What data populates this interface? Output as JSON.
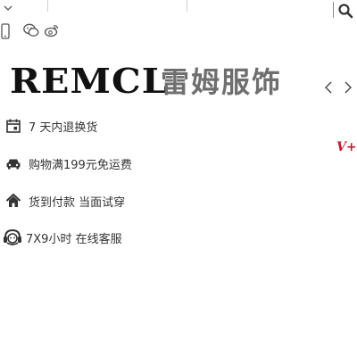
{
  "brand": {
    "name_en": "REMCL",
    "name_cn": "雷姆服饰"
  },
  "badge": {
    "text": "V+",
    "color": "#c0182f"
  },
  "icons": {
    "topbar": [
      "chevron-down-icon",
      "search-icon"
    ],
    "social": [
      "phone-icon",
      "wechat-icon",
      "weibo-icon"
    ],
    "carousel": [
      "chevron-left-icon",
      "chevron-right-icon"
    ]
  },
  "services": [
    {
      "icon": "calendar-icon",
      "text": "7 天内退换货"
    },
    {
      "icon": "car-icon",
      "text": "购物满199元免运费"
    },
    {
      "icon": "home-icon",
      "text": "货到付款 当面试穿"
    },
    {
      "icon": "customer-service-icon",
      "text": "7X9小时 在线客服"
    }
  ]
}
